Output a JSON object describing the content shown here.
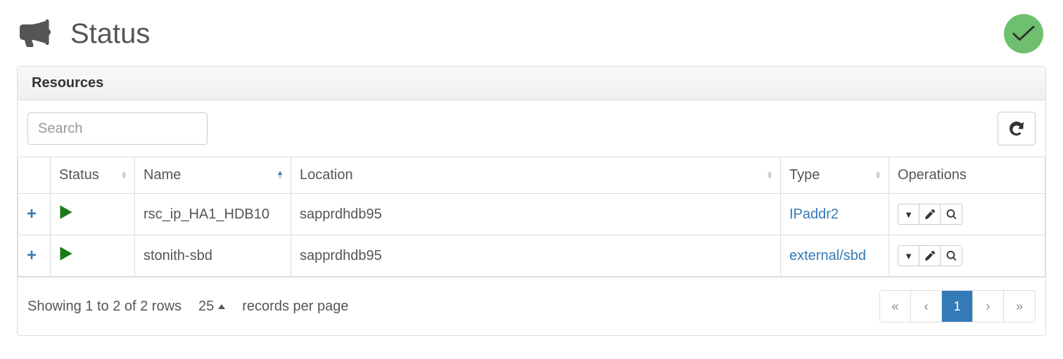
{
  "page_title": "Status",
  "panel_title": "Resources",
  "search": {
    "placeholder": "Search",
    "value": ""
  },
  "columns": {
    "status": "Status",
    "name": "Name",
    "location": "Location",
    "type": "Type",
    "operations": "Operations"
  },
  "sorted_column": "name",
  "sorted_direction": "asc",
  "rows": [
    {
      "status": "running",
      "name": "rsc_ip_HA1_HDB10",
      "location": "sapprdhdb95",
      "type": "IPaddr2"
    },
    {
      "status": "running",
      "name": "stonith-sbd",
      "location": "sapprdhdb95",
      "type": "external/sbd"
    }
  ],
  "footer": {
    "showing_text": "Showing 1 to 2 of 2 rows",
    "page_size": "25",
    "records_label": "records per page"
  },
  "pagination": {
    "first": "«",
    "prev": "‹",
    "current": "1",
    "next": "›",
    "last": "»"
  }
}
